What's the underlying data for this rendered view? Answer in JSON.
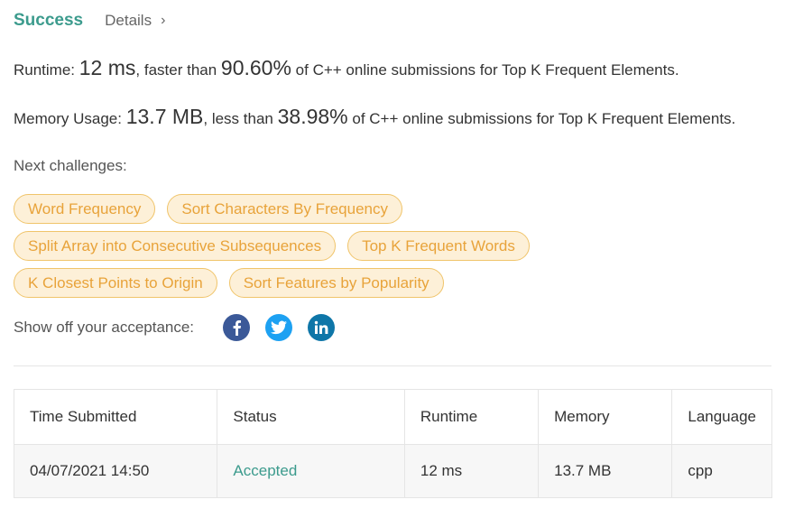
{
  "header": {
    "status": "Success",
    "details_label": "Details"
  },
  "runtime": {
    "label": "Runtime:",
    "value": "12 ms",
    "mid": ", faster than",
    "percent": "90.60%",
    "suffix": "of C++ online submissions for Top K Frequent Elements."
  },
  "memory": {
    "label": "Memory Usage:",
    "value": "13.7 MB",
    "mid": ", less than",
    "percent": "38.98%",
    "suffix": "of C++ online submissions for Top K Frequent Elements."
  },
  "next_challenges": {
    "label": "Next challenges:",
    "rows": [
      [
        "Word Frequency",
        "Sort Characters By Frequency"
      ],
      [
        "Split Array into Consecutive Subsequences",
        "Top K Frequent Words"
      ],
      [
        "K Closest Points to Origin",
        "Sort Features by Popularity"
      ]
    ]
  },
  "share": {
    "label": "Show off your acceptance:",
    "icons": [
      "facebook-icon",
      "twitter-icon",
      "linkedin-icon"
    ],
    "colors": {
      "facebook": "#3b5998",
      "twitter": "#1da1f2",
      "linkedin": "#0e76a8"
    }
  },
  "table": {
    "headers": [
      "Time Submitted",
      "Status",
      "Runtime",
      "Memory",
      "Language"
    ],
    "rows": [
      [
        "04/07/2021 14:50",
        "Accepted",
        "12 ms",
        "13.7 MB",
        "cpp"
      ]
    ]
  },
  "colors": {
    "success": "#3c9b8d",
    "chip_text": "#e8a33a",
    "chip_bg": "#fdf0d8",
    "chip_border": "#f0c46a"
  }
}
